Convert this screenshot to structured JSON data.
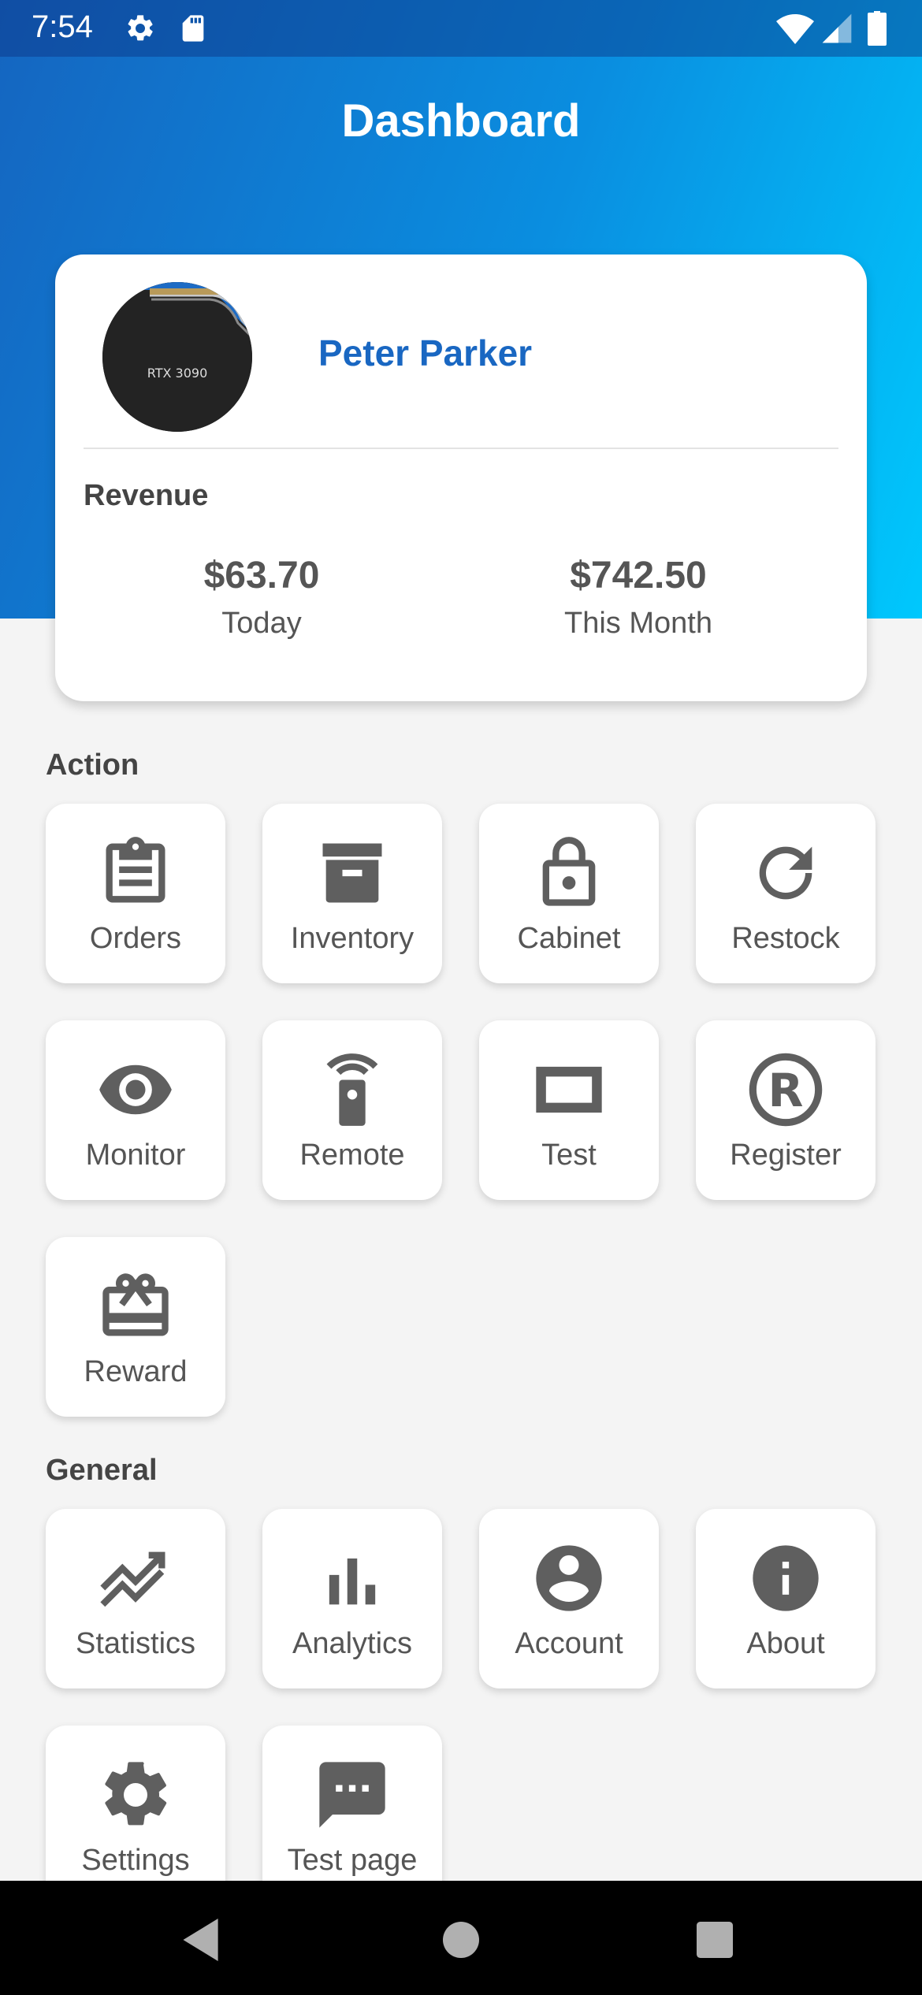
{
  "status": {
    "time": "7:54"
  },
  "header": {
    "title": "Dashboard"
  },
  "profile": {
    "name": "Peter Parker",
    "avatar_text": "RTX 3090",
    "revenue_label": "Revenue",
    "today": {
      "value": "$63.70",
      "label": "Today"
    },
    "month": {
      "value": "$742.50",
      "label": "This Month"
    }
  },
  "action": {
    "title": "Action",
    "items": [
      {
        "label": "Orders",
        "icon": "clipboard-icon"
      },
      {
        "label": "Inventory",
        "icon": "archive-icon"
      },
      {
        "label": "Cabinet",
        "icon": "lock-open-icon"
      },
      {
        "label": "Restock",
        "icon": "refresh-icon"
      },
      {
        "label": "Monitor",
        "icon": "eye-icon"
      },
      {
        "label": "Remote",
        "icon": "remote-icon"
      },
      {
        "label": "Test",
        "icon": "crop-square-icon"
      },
      {
        "label": "Register",
        "icon": "registered-icon"
      },
      {
        "label": "Reward",
        "icon": "gift-card-icon"
      }
    ]
  },
  "general": {
    "title": "General",
    "items": [
      {
        "label": "Statistics",
        "icon": "trending-icon"
      },
      {
        "label": "Analytics",
        "icon": "bar-chart-icon"
      },
      {
        "label": "Account",
        "icon": "account-circle-icon"
      },
      {
        "label": "About",
        "icon": "info-icon"
      },
      {
        "label": "Settings",
        "icon": "gear-icon"
      },
      {
        "label": "Test page",
        "icon": "message-icon"
      }
    ]
  },
  "colors": {
    "accent": "#1967c2",
    "icon": "#5f5f5f"
  }
}
